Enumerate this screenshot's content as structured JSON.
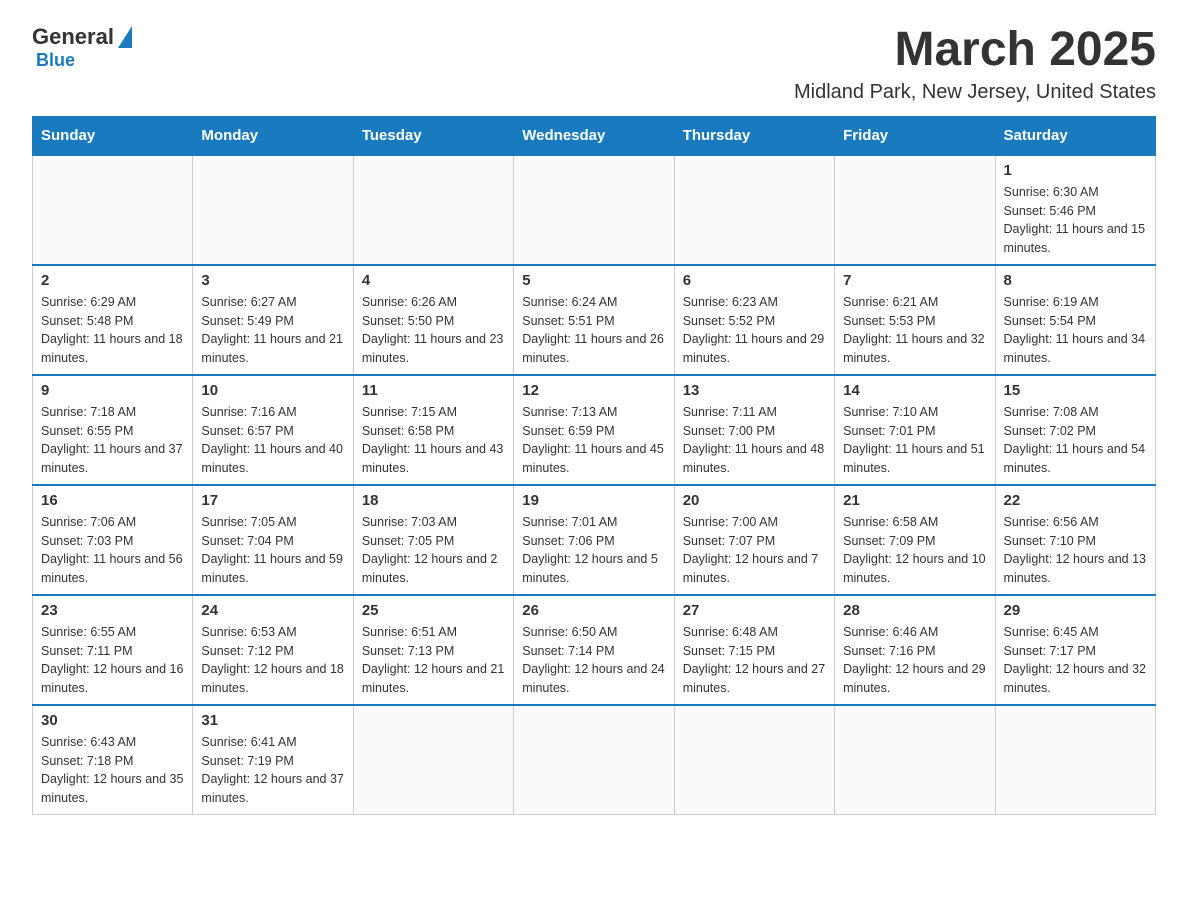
{
  "logo": {
    "general": "General",
    "blue": "Blue"
  },
  "header": {
    "month": "March 2025",
    "location": "Midland Park, New Jersey, United States"
  },
  "weekdays": [
    "Sunday",
    "Monday",
    "Tuesday",
    "Wednesday",
    "Thursday",
    "Friday",
    "Saturday"
  ],
  "weeks": [
    [
      {
        "day": "",
        "sunrise": "",
        "sunset": "",
        "daylight": ""
      },
      {
        "day": "",
        "sunrise": "",
        "sunset": "",
        "daylight": ""
      },
      {
        "day": "",
        "sunrise": "",
        "sunset": "",
        "daylight": ""
      },
      {
        "day": "",
        "sunrise": "",
        "sunset": "",
        "daylight": ""
      },
      {
        "day": "",
        "sunrise": "",
        "sunset": "",
        "daylight": ""
      },
      {
        "day": "",
        "sunrise": "",
        "sunset": "",
        "daylight": ""
      },
      {
        "day": "1",
        "sunrise": "Sunrise: 6:30 AM",
        "sunset": "Sunset: 5:46 PM",
        "daylight": "Daylight: 11 hours and 15 minutes."
      }
    ],
    [
      {
        "day": "2",
        "sunrise": "Sunrise: 6:29 AM",
        "sunset": "Sunset: 5:48 PM",
        "daylight": "Daylight: 11 hours and 18 minutes."
      },
      {
        "day": "3",
        "sunrise": "Sunrise: 6:27 AM",
        "sunset": "Sunset: 5:49 PM",
        "daylight": "Daylight: 11 hours and 21 minutes."
      },
      {
        "day": "4",
        "sunrise": "Sunrise: 6:26 AM",
        "sunset": "Sunset: 5:50 PM",
        "daylight": "Daylight: 11 hours and 23 minutes."
      },
      {
        "day": "5",
        "sunrise": "Sunrise: 6:24 AM",
        "sunset": "Sunset: 5:51 PM",
        "daylight": "Daylight: 11 hours and 26 minutes."
      },
      {
        "day": "6",
        "sunrise": "Sunrise: 6:23 AM",
        "sunset": "Sunset: 5:52 PM",
        "daylight": "Daylight: 11 hours and 29 minutes."
      },
      {
        "day": "7",
        "sunrise": "Sunrise: 6:21 AM",
        "sunset": "Sunset: 5:53 PM",
        "daylight": "Daylight: 11 hours and 32 minutes."
      },
      {
        "day": "8",
        "sunrise": "Sunrise: 6:19 AM",
        "sunset": "Sunset: 5:54 PM",
        "daylight": "Daylight: 11 hours and 34 minutes."
      }
    ],
    [
      {
        "day": "9",
        "sunrise": "Sunrise: 7:18 AM",
        "sunset": "Sunset: 6:55 PM",
        "daylight": "Daylight: 11 hours and 37 minutes."
      },
      {
        "day": "10",
        "sunrise": "Sunrise: 7:16 AM",
        "sunset": "Sunset: 6:57 PM",
        "daylight": "Daylight: 11 hours and 40 minutes."
      },
      {
        "day": "11",
        "sunrise": "Sunrise: 7:15 AM",
        "sunset": "Sunset: 6:58 PM",
        "daylight": "Daylight: 11 hours and 43 minutes."
      },
      {
        "day": "12",
        "sunrise": "Sunrise: 7:13 AM",
        "sunset": "Sunset: 6:59 PM",
        "daylight": "Daylight: 11 hours and 45 minutes."
      },
      {
        "day": "13",
        "sunrise": "Sunrise: 7:11 AM",
        "sunset": "Sunset: 7:00 PM",
        "daylight": "Daylight: 11 hours and 48 minutes."
      },
      {
        "day": "14",
        "sunrise": "Sunrise: 7:10 AM",
        "sunset": "Sunset: 7:01 PM",
        "daylight": "Daylight: 11 hours and 51 minutes."
      },
      {
        "day": "15",
        "sunrise": "Sunrise: 7:08 AM",
        "sunset": "Sunset: 7:02 PM",
        "daylight": "Daylight: 11 hours and 54 minutes."
      }
    ],
    [
      {
        "day": "16",
        "sunrise": "Sunrise: 7:06 AM",
        "sunset": "Sunset: 7:03 PM",
        "daylight": "Daylight: 11 hours and 56 minutes."
      },
      {
        "day": "17",
        "sunrise": "Sunrise: 7:05 AM",
        "sunset": "Sunset: 7:04 PM",
        "daylight": "Daylight: 11 hours and 59 minutes."
      },
      {
        "day": "18",
        "sunrise": "Sunrise: 7:03 AM",
        "sunset": "Sunset: 7:05 PM",
        "daylight": "Daylight: 12 hours and 2 minutes."
      },
      {
        "day": "19",
        "sunrise": "Sunrise: 7:01 AM",
        "sunset": "Sunset: 7:06 PM",
        "daylight": "Daylight: 12 hours and 5 minutes."
      },
      {
        "day": "20",
        "sunrise": "Sunrise: 7:00 AM",
        "sunset": "Sunset: 7:07 PM",
        "daylight": "Daylight: 12 hours and 7 minutes."
      },
      {
        "day": "21",
        "sunrise": "Sunrise: 6:58 AM",
        "sunset": "Sunset: 7:09 PM",
        "daylight": "Daylight: 12 hours and 10 minutes."
      },
      {
        "day": "22",
        "sunrise": "Sunrise: 6:56 AM",
        "sunset": "Sunset: 7:10 PM",
        "daylight": "Daylight: 12 hours and 13 minutes."
      }
    ],
    [
      {
        "day": "23",
        "sunrise": "Sunrise: 6:55 AM",
        "sunset": "Sunset: 7:11 PM",
        "daylight": "Daylight: 12 hours and 16 minutes."
      },
      {
        "day": "24",
        "sunrise": "Sunrise: 6:53 AM",
        "sunset": "Sunset: 7:12 PM",
        "daylight": "Daylight: 12 hours and 18 minutes."
      },
      {
        "day": "25",
        "sunrise": "Sunrise: 6:51 AM",
        "sunset": "Sunset: 7:13 PM",
        "daylight": "Daylight: 12 hours and 21 minutes."
      },
      {
        "day": "26",
        "sunrise": "Sunrise: 6:50 AM",
        "sunset": "Sunset: 7:14 PM",
        "daylight": "Daylight: 12 hours and 24 minutes."
      },
      {
        "day": "27",
        "sunrise": "Sunrise: 6:48 AM",
        "sunset": "Sunset: 7:15 PM",
        "daylight": "Daylight: 12 hours and 27 minutes."
      },
      {
        "day": "28",
        "sunrise": "Sunrise: 6:46 AM",
        "sunset": "Sunset: 7:16 PM",
        "daylight": "Daylight: 12 hours and 29 minutes."
      },
      {
        "day": "29",
        "sunrise": "Sunrise: 6:45 AM",
        "sunset": "Sunset: 7:17 PM",
        "daylight": "Daylight: 12 hours and 32 minutes."
      }
    ],
    [
      {
        "day": "30",
        "sunrise": "Sunrise: 6:43 AM",
        "sunset": "Sunset: 7:18 PM",
        "daylight": "Daylight: 12 hours and 35 minutes."
      },
      {
        "day": "31",
        "sunrise": "Sunrise: 6:41 AM",
        "sunset": "Sunset: 7:19 PM",
        "daylight": "Daylight: 12 hours and 37 minutes."
      },
      {
        "day": "",
        "sunrise": "",
        "sunset": "",
        "daylight": ""
      },
      {
        "day": "",
        "sunrise": "",
        "sunset": "",
        "daylight": ""
      },
      {
        "day": "",
        "sunrise": "",
        "sunset": "",
        "daylight": ""
      },
      {
        "day": "",
        "sunrise": "",
        "sunset": "",
        "daylight": ""
      },
      {
        "day": "",
        "sunrise": "",
        "sunset": "",
        "daylight": ""
      }
    ]
  ]
}
